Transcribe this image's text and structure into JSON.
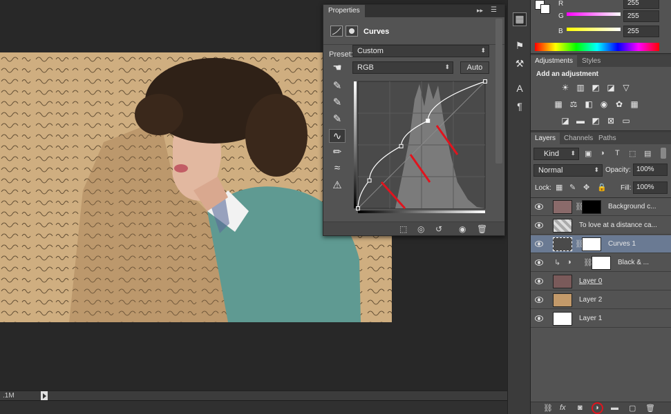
{
  "status": {
    "doc_size": ".1M"
  },
  "properties": {
    "tab": "Properties",
    "title": "Curves",
    "preset_label": "Preset:",
    "preset_value": "Custom",
    "channel_value": "RGB",
    "auto_label": "Auto",
    "curve_points": [
      [
        0,
        0
      ],
      [
        0.09,
        0.22
      ],
      [
        0.34,
        0.49
      ],
      [
        0.55,
        0.69
      ],
      [
        1,
        1
      ]
    ]
  },
  "color": {
    "r_label": "R",
    "g_label": "G",
    "b_label": "B",
    "r_value": "255",
    "g_value": "255",
    "b_value": "255"
  },
  "adjustments": {
    "tabs": [
      "Adjustments",
      "Styles"
    ],
    "title": "Add an adjustment"
  },
  "layers": {
    "tabs": [
      "Layers",
      "Channels",
      "Paths"
    ],
    "kind_value": "Kind",
    "blend_value": "Normal",
    "opacity_label": "Opacity:",
    "opacity_value": "100%",
    "lock_label": "Lock:",
    "fill_label": "Fill:",
    "fill_value": "100%",
    "items": [
      {
        "name": "Background c..."
      },
      {
        "name": "To love at a distance ca..."
      },
      {
        "name": "Curves 1"
      },
      {
        "name": "Black & ..."
      },
      {
        "name": "Layer 0"
      },
      {
        "name": "Layer 2"
      },
      {
        "name": "Layer 1"
      }
    ]
  },
  "colors": {
    "accent_selected": "#6a7a93",
    "highlight_circle": "#e0141e",
    "arrow": "#e0141e"
  }
}
